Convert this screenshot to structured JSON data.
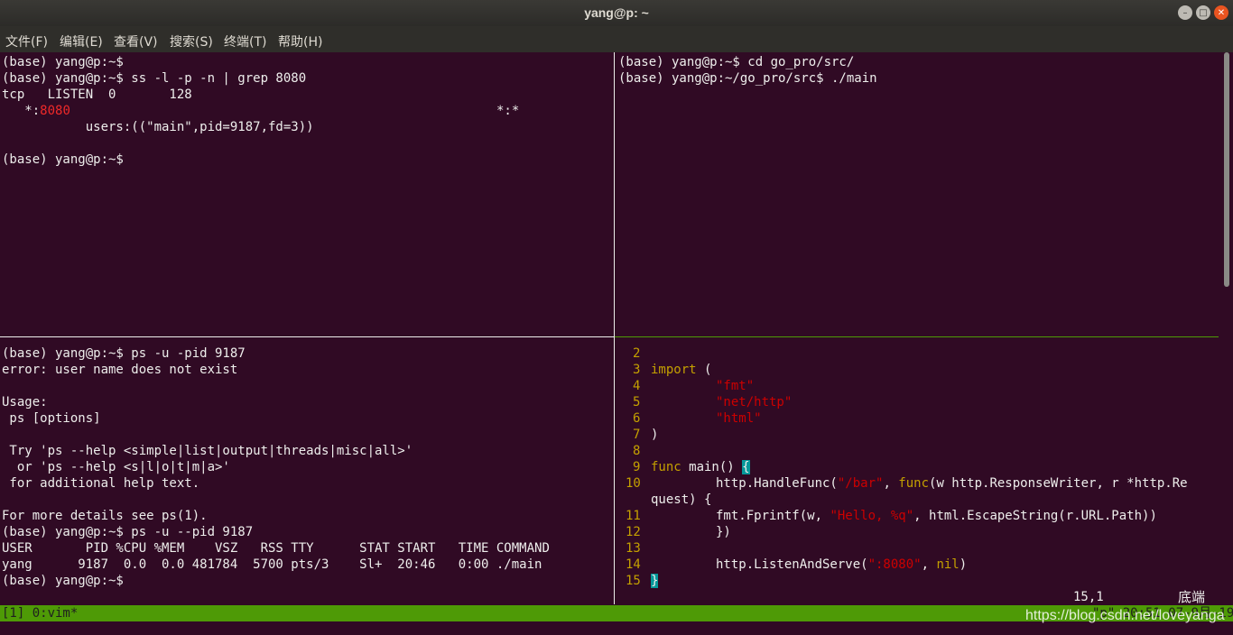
{
  "window": {
    "title": "yang@p: ~"
  },
  "menu": [
    "文件(F)",
    "编辑(E)",
    "查看(V)",
    "搜索(S)",
    "终端(T)",
    "帮助(H)"
  ],
  "top_left_lines": [
    "(base) yang@p:~$",
    "(base) yang@p:~$ ss -l -p -n | grep 8080",
    "tcp   LISTEN  0       128",
    "   *:",
    "           users:((\"main\",pid=9187,fd=3))",
    "",
    "(base) yang@p:~$"
  ],
  "top_left_red": "8080",
  "top_left_star": "*:*",
  "top_right_lines": [
    "(base) yang@p:~$ cd go_pro/src/",
    "(base) yang@p:~/go_pro/src$ ./main"
  ],
  "bottom_left_lines": [
    "(base) yang@p:~$ ps -u -pid 9187",
    "error: user name does not exist",
    "",
    "Usage:",
    " ps [options]",
    "",
    " Try 'ps --help <simple|list|output|threads|misc|all>'",
    "  or 'ps --help <s|l|o|t|m|a>'",
    " for additional help text.",
    "",
    "For more details see ps(1).",
    "(base) yang@p:~$ ps -u --pid 9187",
    "USER       PID %CPU %MEM    VSZ   RSS TTY      STAT START   TIME COMMAND",
    "yang      9187  0.0  0.0 481784  5700 pts/3    Sl+  20:46   0:00 ./main",
    "(base) yang@p:~$"
  ],
  "vim": {
    "line_numbers": [
      "2",
      "3",
      "4",
      "5",
      "6",
      "7",
      "8",
      "9",
      "10",
      "",
      "11",
      "12",
      "13",
      "14",
      "15"
    ],
    "code": {
      "l3_kw": "import",
      "l3_rest": " (",
      "l4": "\"fmt\"",
      "l5": "\"net/http\"",
      "l6": "\"html\"",
      "l7": ")",
      "l9_kw": "func",
      "l9_rest": " main() ",
      "l9_brace": "{",
      "l10_a": "http.HandleFunc(",
      "l10_str": "\"/bar\"",
      "l10_b": ", ",
      "l10_kw": "func",
      "l10_c": "(w http.ResponseWriter, r *http.Re",
      "l10_wrap": "quest) {",
      "l11_a": "fmt.Fprintf(w, ",
      "l11_str": "\"Hello, %q\"",
      "l11_b": ", html.EscapeString(r.URL.Path))",
      "l12": "})",
      "l14_a": "http.ListenAndServe(",
      "l14_str": "\":8080\"",
      "l14_b": ", ",
      "l14_kw": "nil",
      "l14_c": ")",
      "l15": "}"
    },
    "ruler_pos": "15,1",
    "ruler_where": "底端"
  },
  "tmux_status": {
    "left": "[1] 0:vim*",
    "right": "\"p\" 20:51 07-9月-19"
  },
  "watermark": "https://blog.csdn.net/loveyanga"
}
